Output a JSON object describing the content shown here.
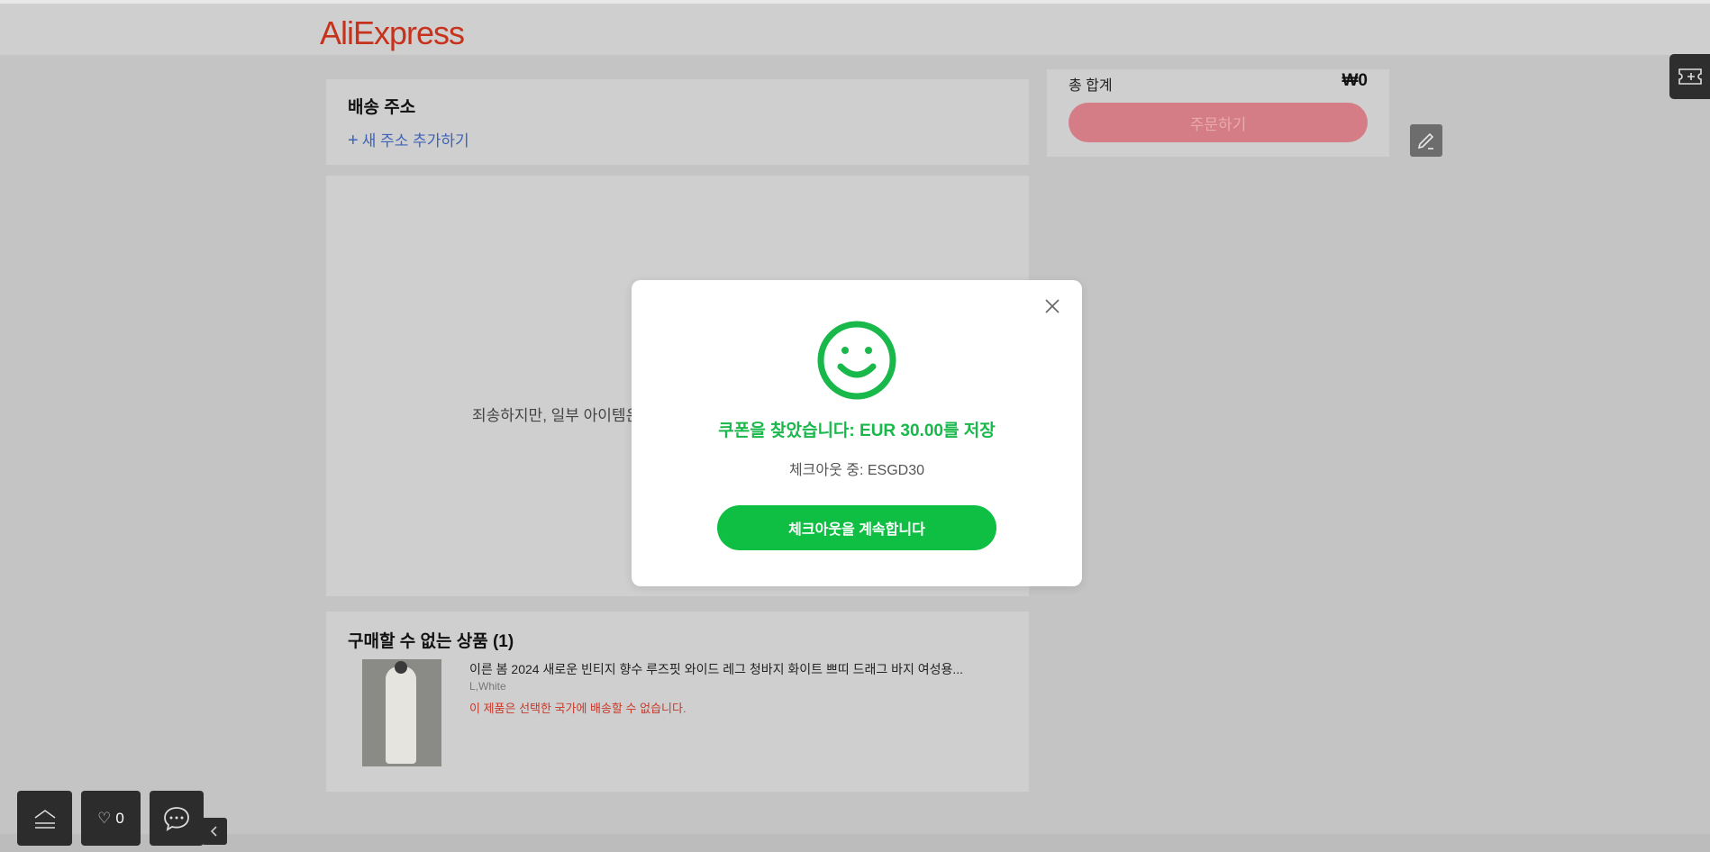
{
  "header": {
    "logo": "AliExpress"
  },
  "address": {
    "title": "배송 주소",
    "add_plus": "+",
    "add_label": "새 주소 추가하기"
  },
  "items_panel": {
    "sorry_text": "죄송하지만, 일부 아이템은"
  },
  "unavailable": {
    "title": "구매할 수 없는 상품 (1)",
    "product": {
      "name": "이른 봄 2024 새로운 빈티지 향수 루즈핏 와이드 레그 청바지 화이트 쁘띠 드래그 바지 여성용...",
      "variant": "L,White",
      "warning": "이 제품은 선택한 국가에 배송할 수 없습니다."
    }
  },
  "summary": {
    "total_label": "총 합계",
    "total_value": "₩0",
    "order_button": "주문하기"
  },
  "modal": {
    "found_text": "쿠폰을 찾았습니다: EUR 30.00를 저장",
    "code_text": "체크아웃 중: ESGD30",
    "continue_button": "체크아웃을 계속합니다"
  },
  "floating": {
    "wishlist_count": "0"
  },
  "icons": {
    "close": "close-icon",
    "smiley": "smiley-icon",
    "edit": "pencil-icon",
    "coupon": "ticket-icon",
    "top": "scroll-top-icon",
    "heart": "heart-icon",
    "chat": "chat-icon",
    "collapse": "chevron-left-icon"
  },
  "colors": {
    "brand": "#c7321c",
    "success": "#18b84a",
    "button_green": "#0fbf43",
    "order_disabled": "#d57d87",
    "link": "#3d63b8",
    "warning": "#c9382a"
  }
}
